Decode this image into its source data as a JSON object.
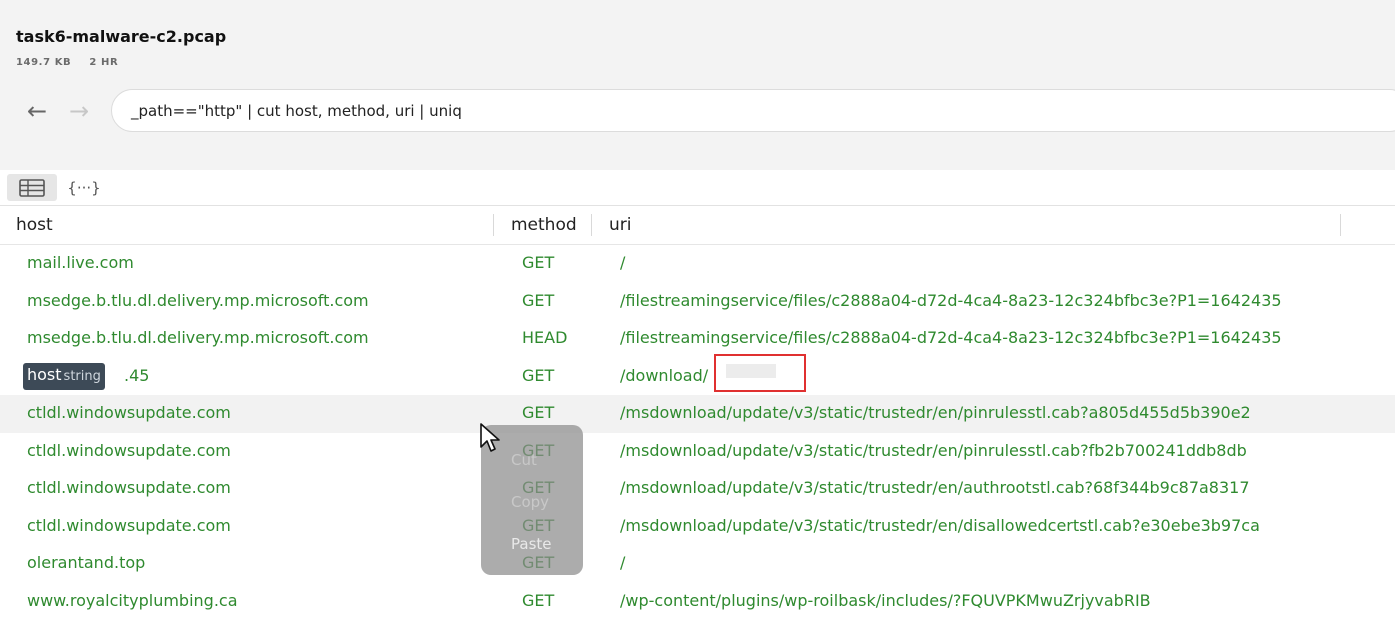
{
  "file": {
    "title": "task6-malware-c2.pcap",
    "size": "149.7 KB",
    "duration": "2 HR"
  },
  "nav": {
    "back_icon": "←",
    "forward_icon": "→"
  },
  "query": {
    "value": "_path==\"http\" | cut host, method, uri | uniq"
  },
  "views": {
    "table_icon": "table-icon",
    "json_icon_glyph": "{···}"
  },
  "columns": {
    "host": "host",
    "method": "method",
    "uri": "uri"
  },
  "rows": [
    {
      "host": "mail.live.com",
      "method": "GET",
      "uri": "/"
    },
    {
      "host": "msedge.b.tlu.dl.delivery.mp.microsoft.com",
      "method": "GET",
      "uri": "/filestreamingservice/files/c2888a04-d72d-4ca4-8a23-12c324bfbc3e?P1=1642435"
    },
    {
      "host": "msedge.b.tlu.dl.delivery.mp.microsoft.com",
      "method": "HEAD",
      "uri": "/filestreamingservice/files/c2888a04-d72d-4ca4-8a23-12c324bfbc3e?P1=1642435"
    },
    {
      "host": ".45",
      "method": "GET",
      "uri": "/download/"
    },
    {
      "host": "ctldl.windowsupdate.com",
      "method": "GET",
      "uri": "/msdownload/update/v3/static/trustedr/en/pinrulesstl.cab?a805d455d5b390e2"
    },
    {
      "host": "ctldl.windowsupdate.com",
      "method": "GET",
      "uri": "/msdownload/update/v3/static/trustedr/en/pinrulesstl.cab?fb2b700241ddb8db"
    },
    {
      "host": "ctldl.windowsupdate.com",
      "method": "GET",
      "uri": "/msdownload/update/v3/static/trustedr/en/authrootstl.cab?68f344b9c87a8317"
    },
    {
      "host": "ctldl.windowsupdate.com",
      "method": "GET",
      "uri": "/msdownload/update/v3/static/trustedr/en/disallowedcertstl.cab?e30ebe3b97ca"
    },
    {
      "host": "olerantand.top",
      "method": "GET",
      "uri": "/"
    },
    {
      "host": "www.royalcityplumbing.ca",
      "method": "GET",
      "uri": "/wp-content/plugins/wp-roilbask/includes/?FQUVPKMwuZrjyvabRIB"
    }
  ],
  "tooltip": {
    "field": "host",
    "type": "string"
  },
  "context_menu": {
    "cut": "Cut",
    "copy": "Copy",
    "paste": "Paste"
  },
  "colors": {
    "value_green": "#2f8a2f",
    "tooltip_bg": "#3d4a57",
    "redaction_border": "#e03030"
  }
}
